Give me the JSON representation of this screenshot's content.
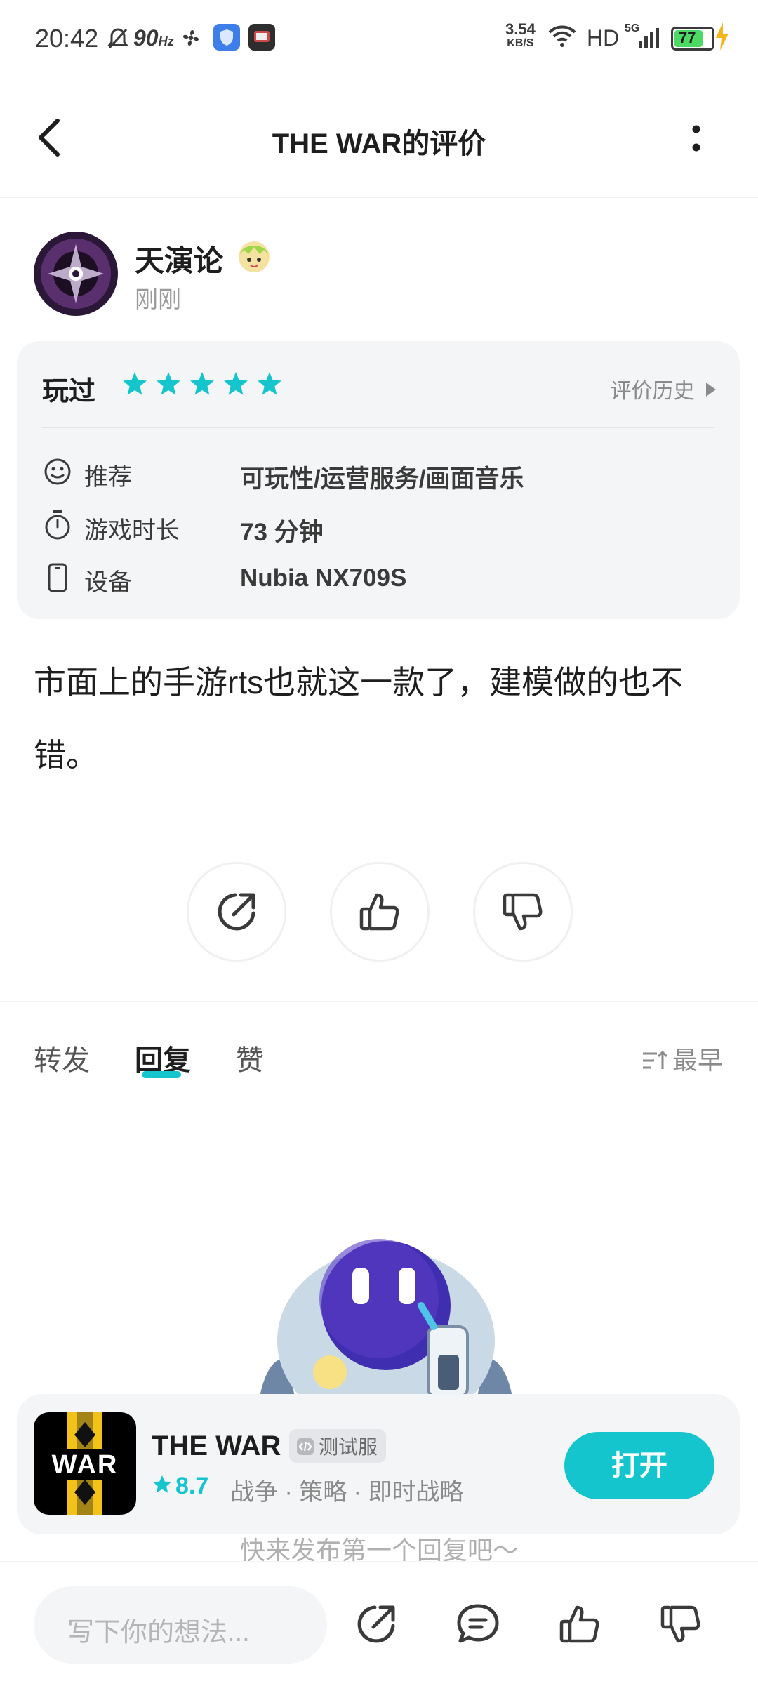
{
  "status_bar": {
    "time": "20:42",
    "refresh_rate": "90",
    "refresh_unit": "Hz",
    "net_speed": "3.54",
    "net_unit": "KB/S",
    "hd": "HD",
    "net_type": "5G",
    "battery": "77"
  },
  "header": {
    "title": "THE WAR的评价"
  },
  "review": {
    "username": "天演论",
    "time": "刚刚",
    "played_label": "玩过",
    "stars": 5,
    "history_label": "评价历史",
    "rows": [
      {
        "label": "推荐",
        "value": "可玩性/运营服务/画面音乐"
      },
      {
        "label": "游戏时长",
        "value": "73 分钟"
      },
      {
        "label": "设备",
        "value": "Nubia NX709S"
      }
    ],
    "content": "市面上的手游rts也就这一款了，建模做的也不错。"
  },
  "tabs": [
    {
      "label": "转发"
    },
    {
      "label": "回复"
    },
    {
      "label": "赞"
    }
  ],
  "sort_label": "最早",
  "game": {
    "logo_text": "WAR",
    "name": "THE WAR",
    "badge": "测试服",
    "rating": "8.7",
    "tags": "战争 · 策略 · 即时战略",
    "open_label": "打开"
  },
  "empty_hint": "快来发布第一个回复吧～",
  "composer": {
    "placeholder": "写下你的想法..."
  },
  "colors": {
    "accent": "#15c5ce",
    "card_bg": "#f4f5f7"
  }
}
